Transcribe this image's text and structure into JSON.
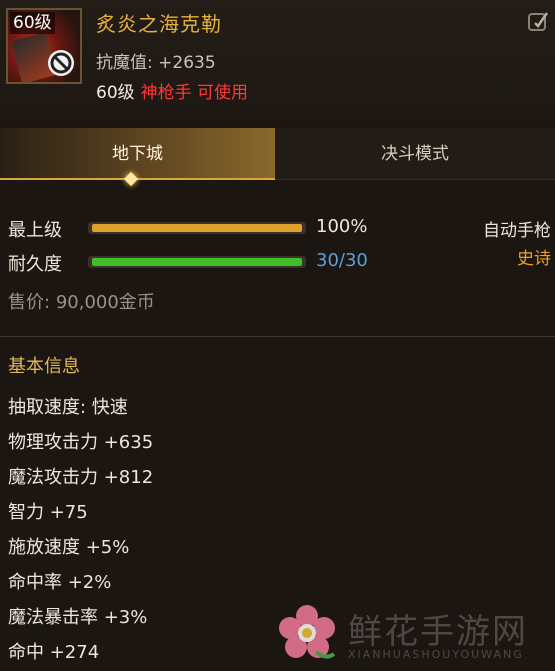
{
  "item": {
    "level_badge": "60级",
    "name": "炙炎之海克勒",
    "resist_label": "抗魔值:",
    "resist_value": "+2635",
    "req_level": "60级",
    "req_class": "神枪手 可使用"
  },
  "tabs": [
    {
      "label": "地下城",
      "active": true
    },
    {
      "label": "决斗模式",
      "active": false
    }
  ],
  "grade": {
    "label": "最上级",
    "value_text": "100%",
    "fill": 1.0,
    "color": "#e0a12b"
  },
  "durability": {
    "label": "耐久度",
    "value_text": "30/30",
    "fill": 1.0,
    "color": "#3fbf2a"
  },
  "side": {
    "type": "自动手枪",
    "rarity": "史诗"
  },
  "price": {
    "label": "售价:",
    "value": "90,000金币"
  },
  "basic_info": {
    "title": "基本信息",
    "lines": [
      "抽取速度: 快速",
      "物理攻击力 +635",
      "魔法攻击力 +812",
      "智力 +75",
      "施放速度 +5%",
      "命中率 +2%",
      "魔法暴击率 +3%",
      "命中 +274"
    ]
  },
  "watermark": {
    "text": "鲜花手游网",
    "sub": "XIANHUASHOUYOUWANG"
  },
  "colors": {
    "accent": "#e8b03c",
    "danger": "#ff3838",
    "rarity": "#f0a020"
  }
}
